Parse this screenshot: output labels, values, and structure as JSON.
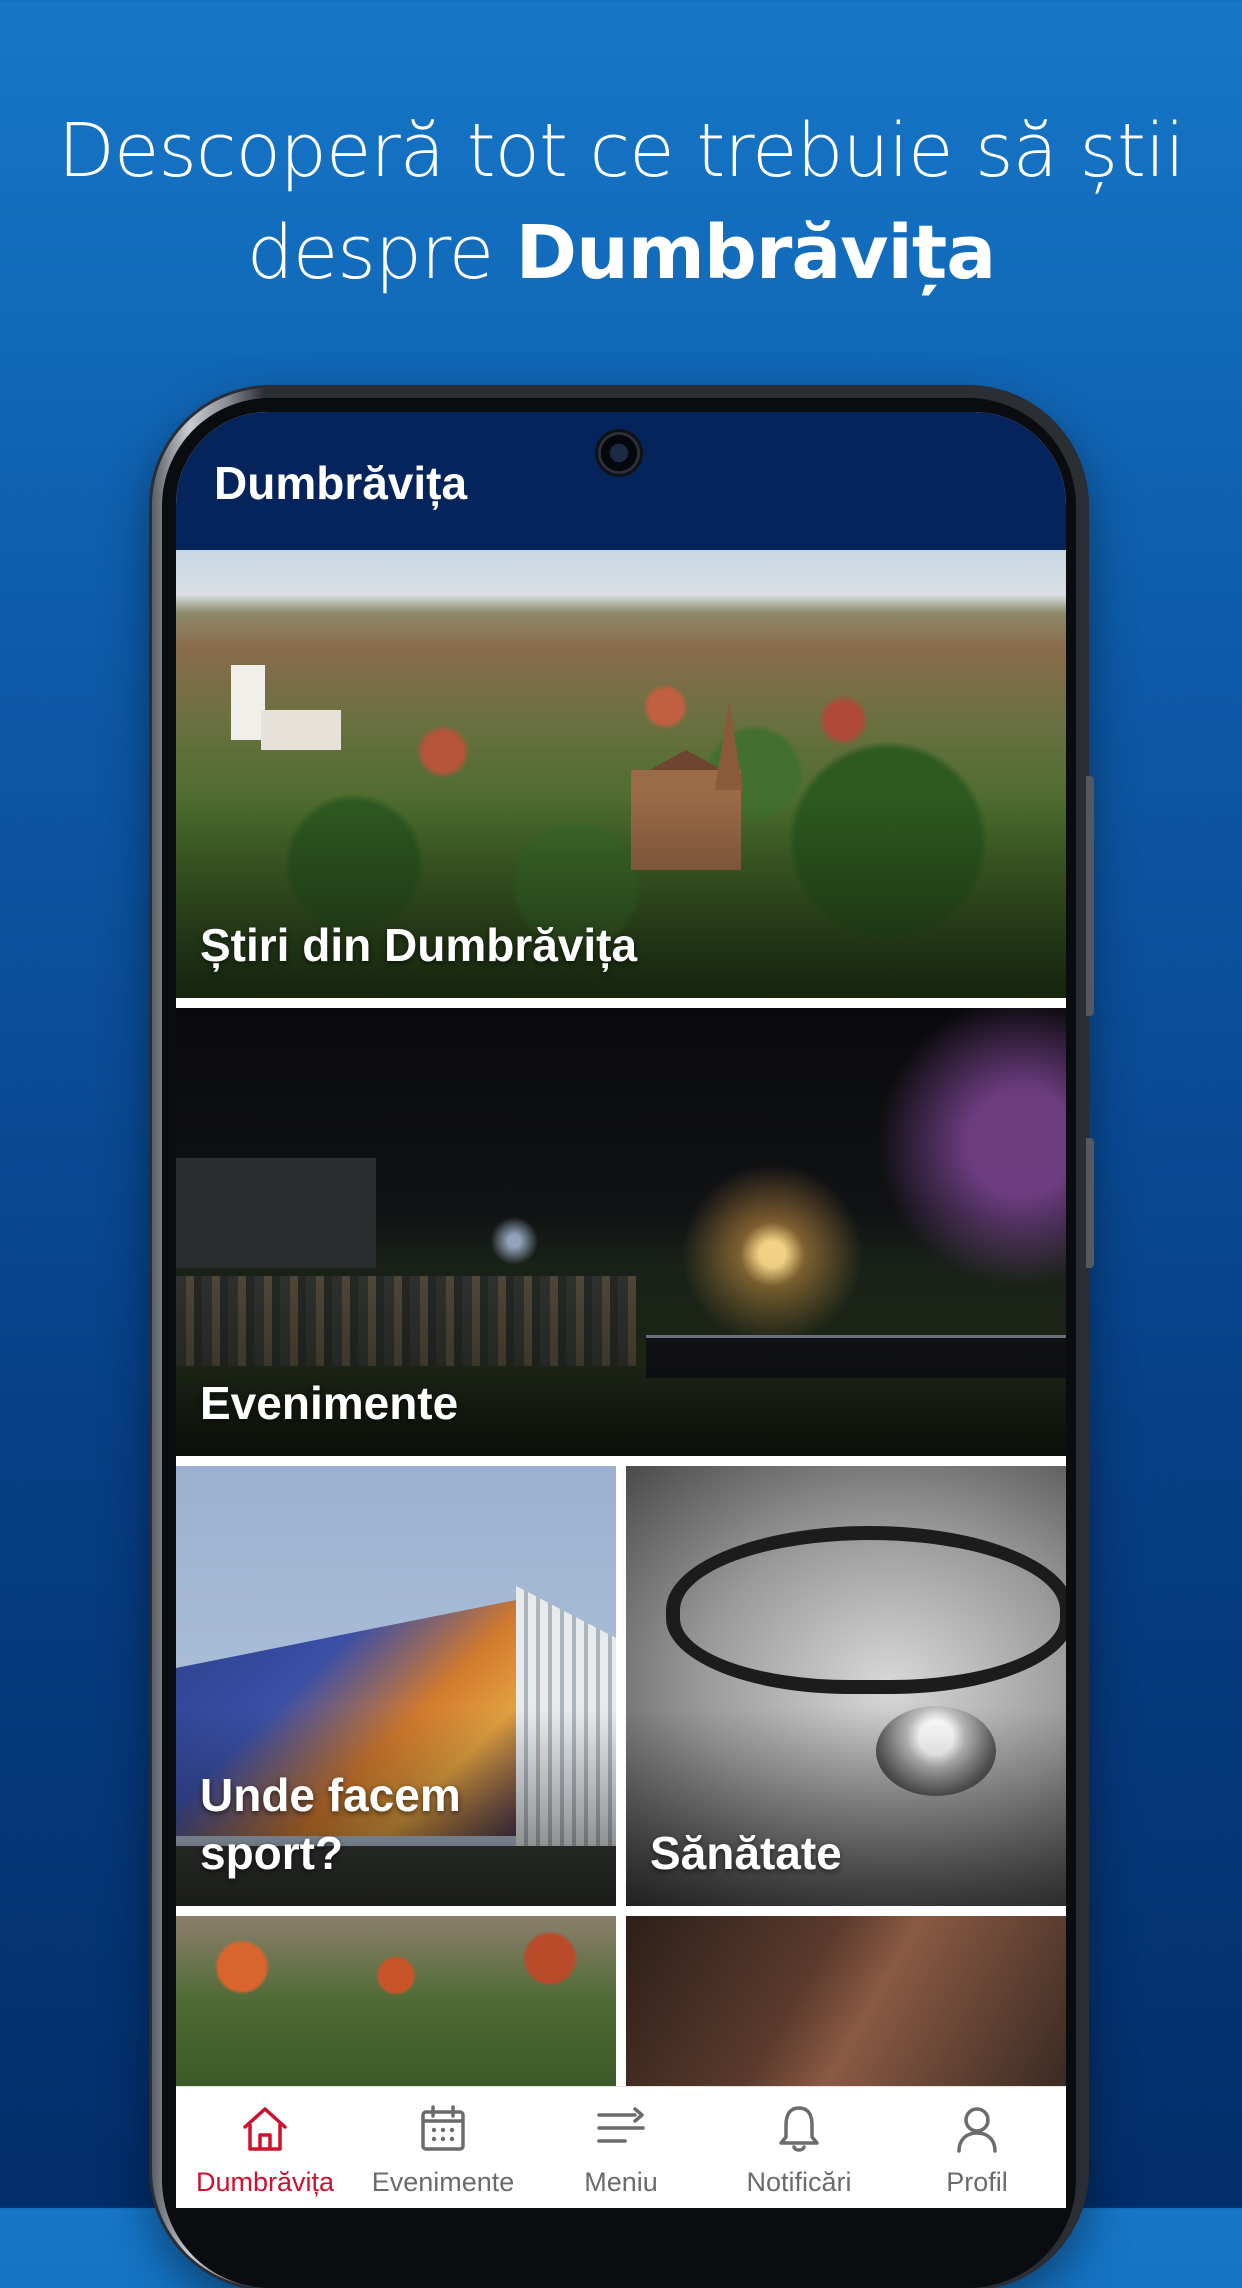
{
  "promo": {
    "line1": "Descoperă tot ce trebuie să știi",
    "line2_pre": "despre ",
    "line2_bold": "Dumbrăvița"
  },
  "app": {
    "title": "Dumbrăvița"
  },
  "tiles": [
    {
      "label": "Știri din Dumbrăvița"
    },
    {
      "label": "Evenimente"
    },
    {
      "label": "Unde facem sport?"
    },
    {
      "label": "Sănătate"
    }
  ],
  "nav": {
    "items": [
      {
        "label": "Dumbrăvița",
        "icon": "home-icon",
        "active": true
      },
      {
        "label": "Evenimente",
        "icon": "calendar-icon",
        "active": false
      },
      {
        "label": "Meniu",
        "icon": "menu-icon",
        "active": false
      },
      {
        "label": "Notificări",
        "icon": "bell-icon",
        "active": false
      },
      {
        "label": "Profil",
        "icon": "user-icon",
        "active": false
      }
    ],
    "active_color": "#d0102c",
    "inactive_color": "#6b6b6b"
  },
  "colors": {
    "appbar": "#05245b",
    "background_top": "#1677c9",
    "background_bottom": "#022e6a"
  }
}
